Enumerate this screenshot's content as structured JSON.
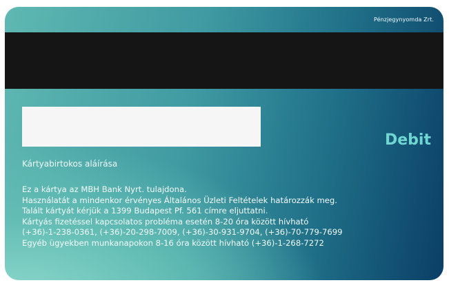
{
  "card": {
    "issuer": "Pénzjegynyomda Zrt.",
    "type_label": "Debit",
    "signature_label": "Kártyabirtokos aláírása",
    "info_lines": [
      "Ez a kártya az MBH Bank Nyrt. tulajdona.",
      "Használatát a mindenkor érvényes Általános Üzleti Feltételek határozzák meg.",
      "Talált kártyát kérjük a 1399 Budapest Pf. 561 címre eljuttatni.",
      "Kártyás fizetéssel kapcsolatos probléma esetén 8-20 óra között hívható",
      "(+36)-1-238-0361,  (+36)-20-298-7009, (+36)-30-931-9704,  (+36)-70-779-7699",
      "Egyéb ügyekben munkanapokon 8-16 óra között hívható (+36)-1-268-7272"
    ]
  },
  "colors": {
    "stripe": "#151515",
    "signature_panel": "#f6f6f6",
    "debit_accent": "#6fd6d1",
    "gradient_light": "#8ed9cc",
    "gradient_dark": "#0b3e66"
  }
}
